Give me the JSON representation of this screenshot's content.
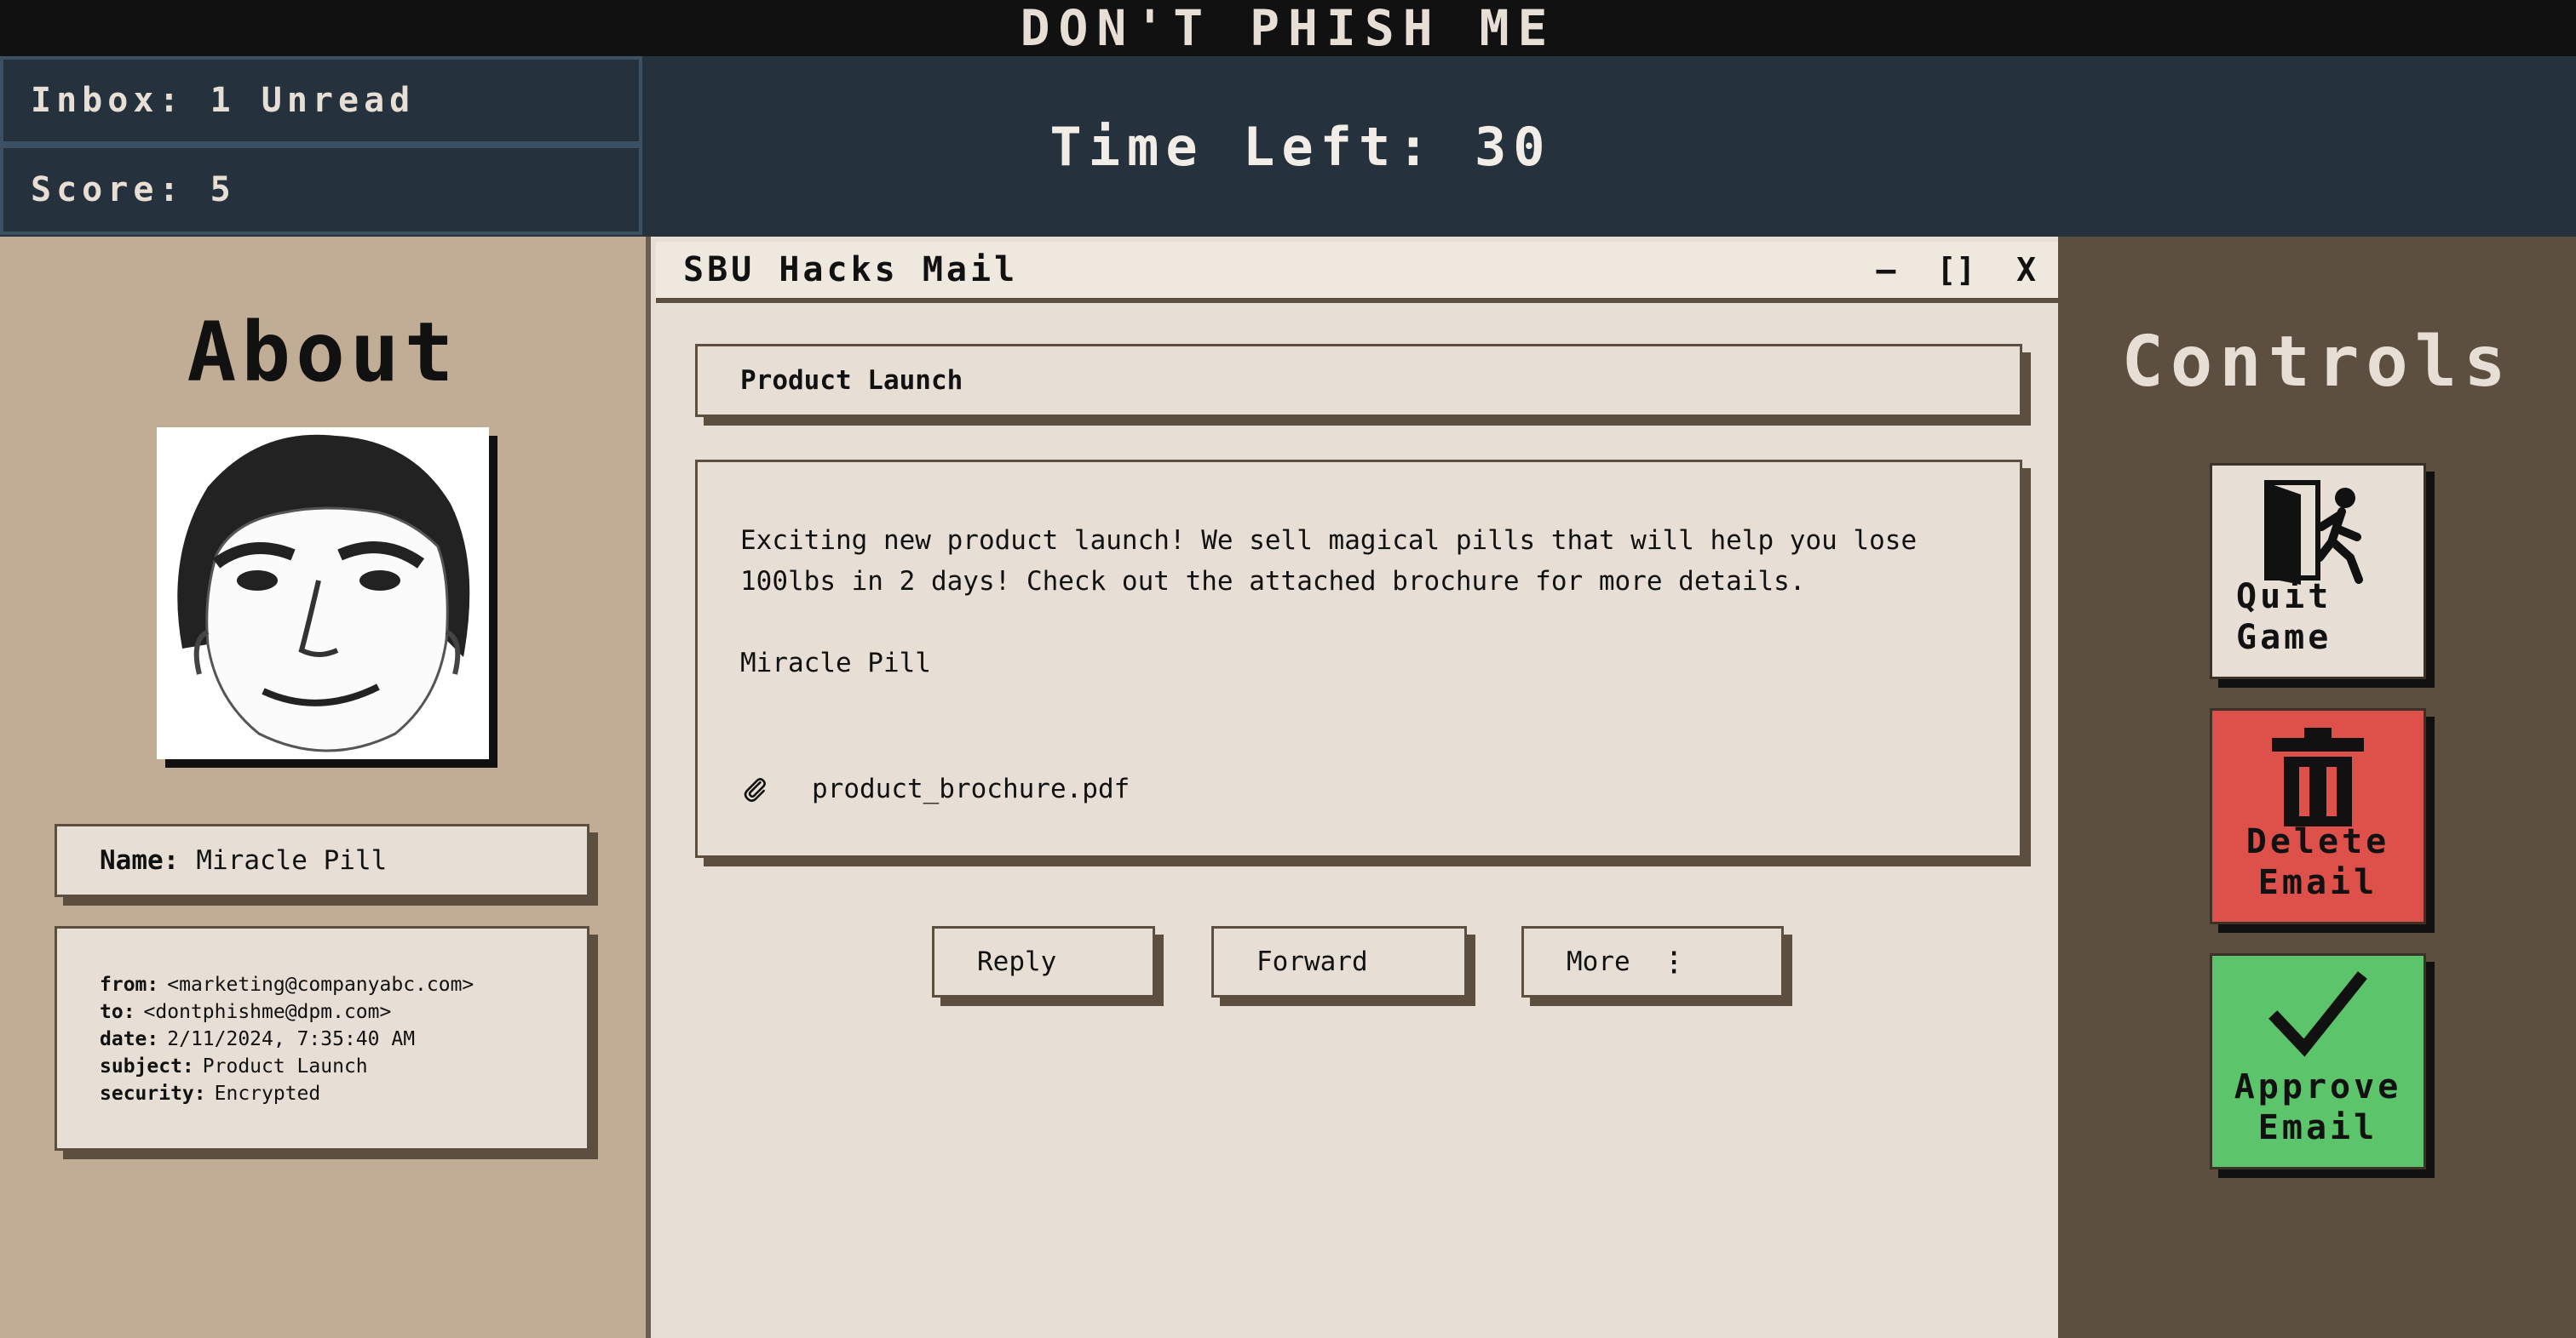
{
  "game": {
    "title": "DON'T PHISH ME",
    "inbox_label": "Inbox: 1 Unread",
    "score_label": "Score: 5",
    "timer_label": "Time Left: 30"
  },
  "about": {
    "title": "About",
    "name_label": "Name:",
    "name_value": "Miracle Pill",
    "meta": {
      "from_label": "from:",
      "from_value": "<marketing@companyabc.com>",
      "to_label": "to:",
      "to_value": "<dontphishme@dpm.com>",
      "date_label": "date:",
      "date_value": "2/11/2024, 7:35:40 AM",
      "subject_label": "subject:",
      "subject_value": "Product Launch",
      "security_label": "security:",
      "security_value": "Encrypted"
    }
  },
  "mail": {
    "window_title": "SBU Hacks Mail",
    "minimize": "–",
    "maximize": "[]",
    "close": "X",
    "subject": "Product Launch",
    "body": "Exciting new product launch! We sell magical pills that will help you lose\n100lbs in 2 days! Check out the attached brochure for more details.",
    "signature": "Miracle Pill",
    "attachment_name": "product_brochure.pdf",
    "attachment_icon": "paperclip-icon",
    "reply_label": "Reply",
    "forward_label": "Forward",
    "more_label": "More"
  },
  "controls": {
    "title": "Controls",
    "quit_label_1": "Quit",
    "quit_label_2": "Game",
    "delete_label_1": "Delete",
    "delete_label_2": "Email",
    "approve_label_1": "Approve",
    "approve_label_2": "Email",
    "delete_color": "#de514b",
    "approve_color": "#5cc46a"
  }
}
